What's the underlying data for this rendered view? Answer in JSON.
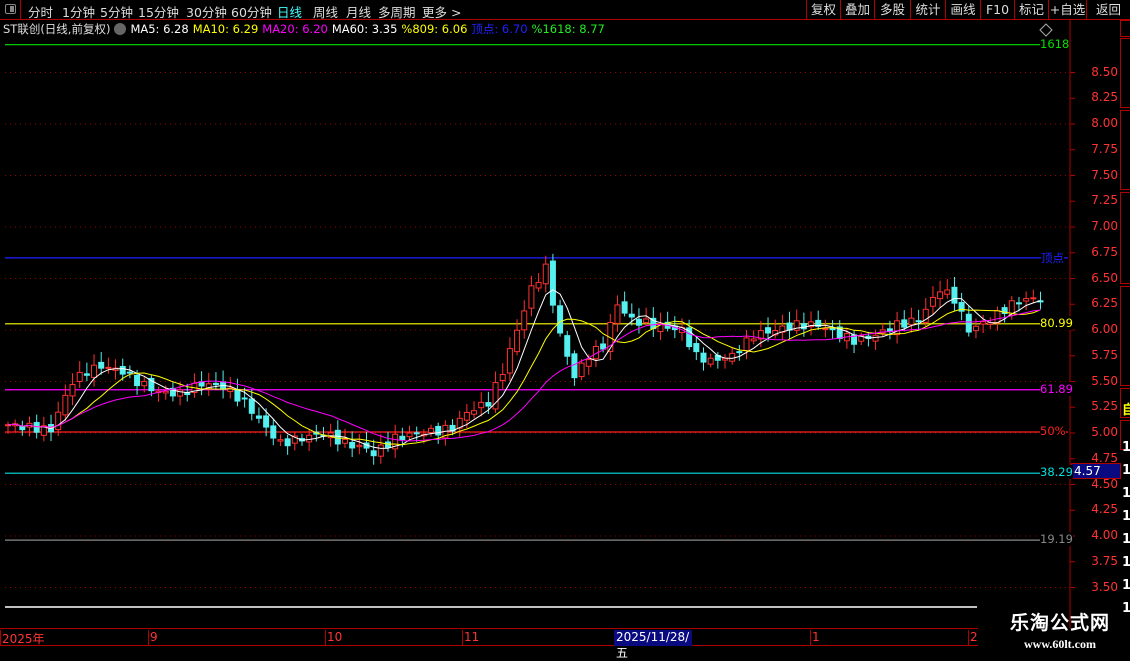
{
  "toolbar": {
    "periods": [
      "分时",
      "1分钟",
      "5分钟",
      "15分钟",
      "30分钟",
      "60分钟",
      "日线",
      "周线",
      "月线",
      "多周期",
      "更多 >"
    ],
    "active_period": "日线",
    "right_buttons": [
      "复权",
      "叠加",
      "多股",
      "统计",
      "画线",
      "F10",
      "标记",
      "+自选",
      "返回"
    ]
  },
  "legend": {
    "title": "ST联创(日线,前复权)",
    "ma5": "MA5: 6.28",
    "ma10": "MA10: 6.29",
    "ma20": "MA20: 6.20",
    "ma60": "MA60: 3.35",
    "p809": "%809: 6.06",
    "top": "顶点: 6.70",
    "p1618": "%1618: 8.77"
  },
  "axis": {
    "ticks": [
      "8.50",
      "8.25",
      "8.00",
      "7.75",
      "7.50",
      "7.25",
      "7.00",
      "6.75",
      "6.50",
      "6.25",
      "6.00",
      "5.75",
      "5.50",
      "5.25",
      "5.00",
      "4.75",
      "4.50",
      "4.25",
      "4.00",
      "3.75",
      "3.50"
    ],
    "current_price": "4.57"
  },
  "levels": [
    {
      "label": "1618",
      "price": 8.77,
      "color": "#00e000"
    },
    {
      "label": "顶点",
      "price": 6.7,
      "color": "#2020ff"
    },
    {
      "label": "80.99",
      "price": 6.06,
      "color": "#ffff00"
    },
    {
      "label": "61.89",
      "price": 5.42,
      "color": "#ff00ff"
    },
    {
      "label": "50%",
      "price": 5.01,
      "color": "#ff2020"
    },
    {
      "label": "38.29",
      "price": 4.61,
      "color": "#00e0e0"
    },
    {
      "label": "19.19",
      "price": 3.96,
      "color": "#888888"
    }
  ],
  "colors": {
    "up": "#ff3030",
    "down": "#55f0f0",
    "ma5": "#ffffff",
    "ma10": "#ffff00",
    "ma20": "#ff00ff"
  },
  "price_path": [
    [
      0,
      5.08
    ],
    [
      6,
      5.03
    ],
    [
      7,
      5.2
    ],
    [
      9,
      5.5
    ],
    [
      11,
      5.6
    ],
    [
      13,
      5.65
    ],
    [
      16,
      5.6
    ],
    [
      18,
      5.5
    ],
    [
      21,
      5.4
    ],
    [
      24,
      5.38
    ],
    [
      27,
      5.48
    ],
    [
      30,
      5.45
    ],
    [
      33,
      5.3
    ],
    [
      36,
      5.05
    ],
    [
      38,
      4.9
    ],
    [
      41,
      4.95
    ],
    [
      44,
      5.0
    ],
    [
      47,
      4.9
    ],
    [
      50,
      4.85
    ],
    [
      51,
      4.8
    ],
    [
      54,
      4.95
    ],
    [
      57,
      5.0
    ],
    [
      60,
      5.02
    ],
    [
      62,
      5.05
    ],
    [
      64,
      5.2
    ],
    [
      67,
      5.3
    ],
    [
      69,
      5.6
    ],
    [
      71,
      6.0
    ],
    [
      73,
      6.4
    ],
    [
      75,
      6.6
    ],
    [
      77,
      5.95
    ],
    [
      79,
      5.55
    ],
    [
      81,
      5.75
    ],
    [
      83,
      5.85
    ],
    [
      85,
      6.25
    ],
    [
      87,
      6.1
    ],
    [
      90,
      6.05
    ],
    [
      94,
      6.0
    ],
    [
      96,
      5.75
    ],
    [
      98,
      5.7
    ],
    [
      101,
      5.75
    ],
    [
      104,
      5.95
    ],
    [
      107,
      6.0
    ],
    [
      110,
      6.05
    ],
    [
      113,
      6.05
    ],
    [
      116,
      5.95
    ],
    [
      118,
      5.9
    ],
    [
      121,
      5.95
    ],
    [
      124,
      6.05
    ],
    [
      127,
      6.1
    ],
    [
      130,
      6.4
    ],
    [
      132,
      6.3
    ],
    [
      134,
      6.0
    ],
    [
      137,
      6.1
    ],
    [
      140,
      6.25
    ],
    [
      142,
      6.3
    ],
    [
      144,
      6.3
    ]
  ],
  "dates": {
    "labels": [
      "2025年",
      "9",
      "10",
      "11",
      "1",
      "2"
    ],
    "selected": "2025/11/28/五"
  },
  "right_panel": {
    "highlight": "自",
    "digit": "1"
  },
  "watermark": {
    "name": "乐淘公式网",
    "url": "www.60lt.com"
  }
}
